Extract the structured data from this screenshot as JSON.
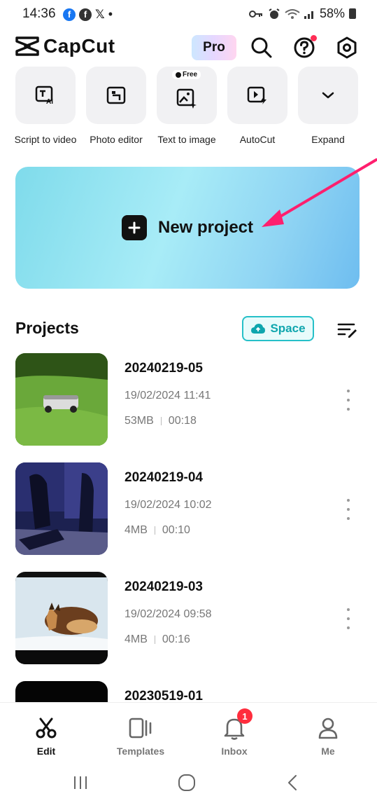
{
  "status_bar": {
    "time": "14:36",
    "battery": "58%"
  },
  "header": {
    "app_name": "CapCut",
    "pro_label": "Pro"
  },
  "tools": [
    {
      "label": "Script to video",
      "icon": "script-to-video-icon"
    },
    {
      "label": "Photo editor",
      "icon": "photo-editor-icon"
    },
    {
      "label": "Text to image",
      "icon": "text-to-image-icon",
      "badge": "Free"
    },
    {
      "label": "AutoCut",
      "icon": "autocut-icon"
    },
    {
      "label": "Expand",
      "icon": "chevron-down-icon"
    }
  ],
  "new_project": {
    "label": "New project"
  },
  "projects_section": {
    "title": "Projects",
    "space_label": "Space"
  },
  "projects": [
    {
      "name": "20240219-05",
      "date": "19/02/2024 11:41",
      "size": "53MB",
      "duration": "00:18"
    },
    {
      "name": "20240219-04",
      "date": "19/02/2024 10:02",
      "size": "4MB",
      "duration": "00:10"
    },
    {
      "name": "20240219-03",
      "date": "19/02/2024 09:58",
      "size": "4MB",
      "duration": "00:16"
    },
    {
      "name": "20230519-01"
    }
  ],
  "bottom_nav": {
    "edit": "Edit",
    "templates": "Templates",
    "inbox": "Inbox",
    "inbox_badge": "1",
    "me": "Me"
  },
  "colors": {
    "accent_teal": "#26c0c8",
    "arrow": "#ff1f6e",
    "badge_red": "#ff2d3d"
  }
}
